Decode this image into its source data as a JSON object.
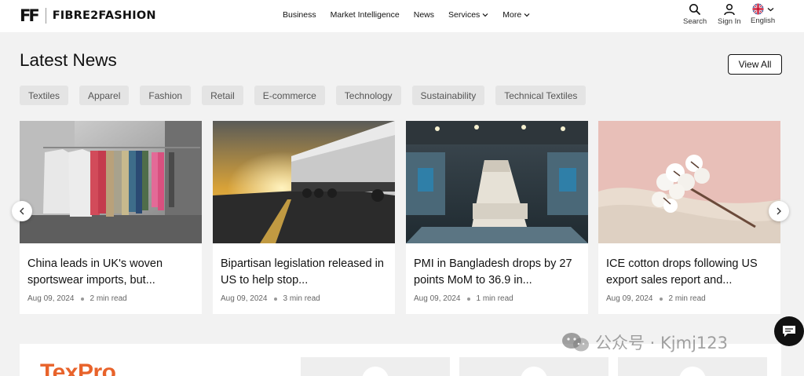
{
  "header": {
    "logo_mark": "FF",
    "logo_text": "FIBRE2FASHION",
    "nav": [
      {
        "label": "Business",
        "dropdown": false
      },
      {
        "label": "Market Intelligence",
        "dropdown": false
      },
      {
        "label": "News",
        "dropdown": false
      },
      {
        "label": "Services",
        "dropdown": true
      },
      {
        "label": "More",
        "dropdown": true
      }
    ],
    "search_label": "Search",
    "signin_label": "Sign In",
    "language_label": "English"
  },
  "section": {
    "title": "Latest News",
    "view_all": "View All"
  },
  "chips": [
    "Textiles",
    "Apparel",
    "Fashion",
    "Retail",
    "E-commerce",
    "Technology",
    "Sustainability",
    "Technical Textiles"
  ],
  "cards": [
    {
      "title": "China leads in UK's woven sportswear imports, but...",
      "date": "Aug 09, 2024",
      "read": "2 min read",
      "image": "hoodies-on-rack"
    },
    {
      "title": "Bipartisan legislation released in US to help stop...",
      "date": "Aug 09, 2024",
      "read": "3 min read",
      "image": "truck-on-highway"
    },
    {
      "title": "PMI in Bangladesh drops by 27 points MoM to 36.9 in...",
      "date": "Aug 09, 2024",
      "read": "1 min read",
      "image": "textile-factory"
    },
    {
      "title": "ICE cotton drops following US export sales report and...",
      "date": "Aug 09, 2024",
      "read": "2 min read",
      "image": "cotton-bolls"
    }
  ],
  "bottom": {
    "brand": "TexPro"
  },
  "watermark": "公众号 · Kjmj123",
  "colors": {
    "accent_orange": "#e8632b",
    "chip_bg": "#e4e4e4",
    "page_bg": "#f2f2f2"
  }
}
